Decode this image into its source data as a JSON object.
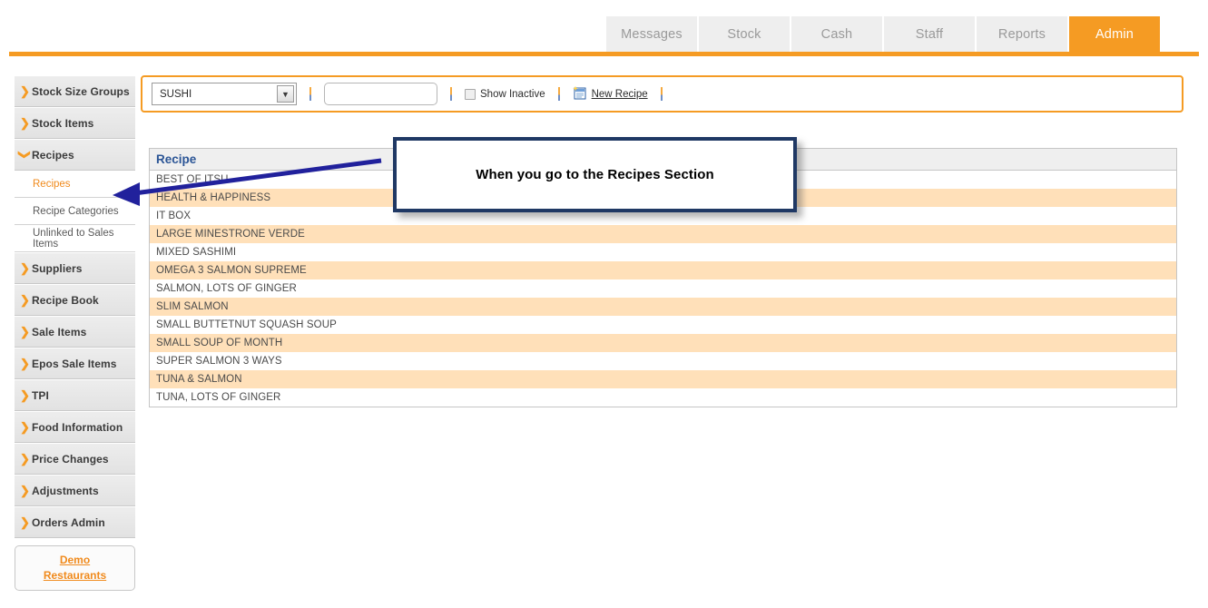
{
  "app": {
    "brand": ""
  },
  "topnav": {
    "tabs": [
      {
        "label": "Messages",
        "active": false
      },
      {
        "label": "Stock",
        "active": false
      },
      {
        "label": "Cash",
        "active": false
      },
      {
        "label": "Staff",
        "active": false
      },
      {
        "label": "Reports",
        "active": false
      },
      {
        "label": "Admin",
        "active": true
      }
    ],
    "accent_color": "#f59b23"
  },
  "sidebar": {
    "items": [
      {
        "label": "Stock Size Groups",
        "icon": "chevron-right-icon",
        "expanded": false
      },
      {
        "label": "Stock Items",
        "icon": "chevron-right-icon",
        "expanded": false
      },
      {
        "label": "Recipes",
        "icon": "chevron-down-icon",
        "expanded": true
      },
      {
        "label": "Suppliers",
        "icon": "chevron-right-icon",
        "expanded": false
      },
      {
        "label": "Recipe Book",
        "icon": "chevron-right-icon",
        "expanded": false
      },
      {
        "label": "Sale Items",
        "icon": "chevron-right-icon",
        "expanded": false
      },
      {
        "label": "Epos Sale Items",
        "icon": "chevron-right-icon",
        "expanded": false
      },
      {
        "label": "TPI",
        "icon": "chevron-right-icon",
        "expanded": false
      },
      {
        "label": "Food Information",
        "icon": "chevron-right-icon",
        "expanded": false
      },
      {
        "label": "Price Changes",
        "icon": "chevron-right-icon",
        "expanded": false
      },
      {
        "label": "Adjustments",
        "icon": "chevron-right-icon",
        "expanded": false
      },
      {
        "label": "Orders Admin",
        "icon": "chevron-right-icon",
        "expanded": false
      }
    ],
    "subitems": [
      {
        "label": "Recipes",
        "current": true
      },
      {
        "label": "Recipe Categories",
        "current": false
      },
      {
        "label": "Unlinked to Sales Items",
        "current": false
      }
    ],
    "footer_button": {
      "line1": "Demo",
      "line2": "Restaurants"
    }
  },
  "toolbar": {
    "category_select": {
      "value": "SUSHI",
      "options": [
        "SUSHI"
      ]
    },
    "search": {
      "value": "",
      "placeholder": ""
    },
    "show_inactive": {
      "label": "Show Inactive",
      "checked": false
    },
    "new_recipe": {
      "label": "New Recipe",
      "icon": "new-document-icon"
    }
  },
  "table": {
    "columns": [
      "Recipe"
    ],
    "rows": [
      "BEST OF ITSU",
      "HEALTH & HAPPINESS",
      "IT BOX",
      "LARGE MINESTRONE VERDE",
      "MIXED SASHIMI",
      "OMEGA 3 SALMON SUPREME",
      "SALMON, LOTS OF GINGER",
      "SLIM SALMON",
      "SMALL BUTTETNUT SQUASH SOUP",
      "SMALL SOUP OF MONTH",
      "SUPER SALMON 3 WAYS",
      "TUNA & SALMON",
      "TUNA, LOTS OF GINGER"
    ],
    "row_alt_color": "#ffe0b9",
    "header_text_color": "#2b5596"
  },
  "annotation": {
    "callout_text": "When you go to the Recipes Section",
    "border_color": "#1f3864",
    "arrow_color": "#21219c"
  }
}
